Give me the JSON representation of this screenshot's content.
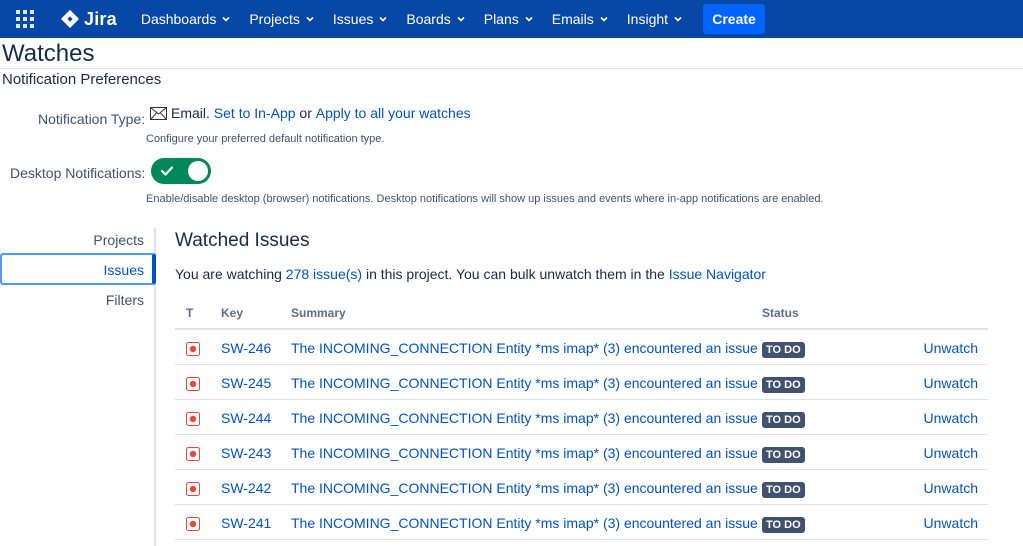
{
  "nav": {
    "brand": "Jira",
    "items": [
      {
        "label": "Dashboards"
      },
      {
        "label": "Projects"
      },
      {
        "label": "Issues"
      },
      {
        "label": "Boards"
      },
      {
        "label": "Plans"
      },
      {
        "label": "Emails"
      },
      {
        "label": "Insight"
      }
    ],
    "create_label": "Create"
  },
  "page": {
    "title": "Watches",
    "prefs_title": "Notification Preferences"
  },
  "notification": {
    "label": "Notification Type:",
    "current": "Email.",
    "set_link": "Set to In-App",
    "or_text": "or",
    "apply_link": "Apply to all your watches",
    "hint": "Configure your preferred default notification type."
  },
  "desktop": {
    "label": "Desktop Notifications:",
    "enabled": true,
    "hint": "Enable/disable desktop (browser) notifications. Desktop notifications will show up issues and events where in-app notifications are enabled."
  },
  "sidemenu": {
    "projects": "Projects",
    "issues": "Issues",
    "filters": "Filters"
  },
  "watched": {
    "title": "Watched Issues",
    "text_before": "You are watching",
    "count_link": "278 issue(s)",
    "text_middle": "in this project. You can bulk unwatch them in the",
    "navigator_link": "Issue Navigator",
    "columns": {
      "t": "T",
      "key": "Key",
      "summary": "Summary",
      "status": "Status"
    },
    "rows": [
      {
        "key": "SW-246",
        "summary": "The INCOMING_CONNECTION Entity *ms imap* (3) encountered an issue",
        "status": "TO DO",
        "action": "Unwatch"
      },
      {
        "key": "SW-245",
        "summary": "The INCOMING_CONNECTION Entity *ms imap* (3) encountered an issue",
        "status": "TO DO",
        "action": "Unwatch"
      },
      {
        "key": "SW-244",
        "summary": "The INCOMING_CONNECTION Entity *ms imap* (3) encountered an issue",
        "status": "TO DO",
        "action": "Unwatch"
      },
      {
        "key": "SW-243",
        "summary": "The INCOMING_CONNECTION Entity *ms imap* (3) encountered an issue",
        "status": "TO DO",
        "action": "Unwatch"
      },
      {
        "key": "SW-242",
        "summary": "The INCOMING_CONNECTION Entity *ms imap* (3) encountered an issue",
        "status": "TO DO",
        "action": "Unwatch"
      },
      {
        "key": "SW-241",
        "summary": "The INCOMING_CONNECTION Entity *ms imap* (3) encountered an issue",
        "status": "TO DO",
        "action": "Unwatch"
      }
    ]
  },
  "colors": {
    "nav_bg": "#0747a6",
    "create_bg": "#0065ff",
    "link": "#0052cc",
    "toggle_on": "#00875a",
    "bug_red": "#e5493a",
    "lozenge": "#42526e"
  },
  "icons": {
    "apps": "app-switcher-icon",
    "brand": "jira-logo-icon",
    "chevron": "chevron-down-icon",
    "email": "envelope-icon",
    "toggle": "check-icon",
    "issue_type": "bug-icon"
  }
}
